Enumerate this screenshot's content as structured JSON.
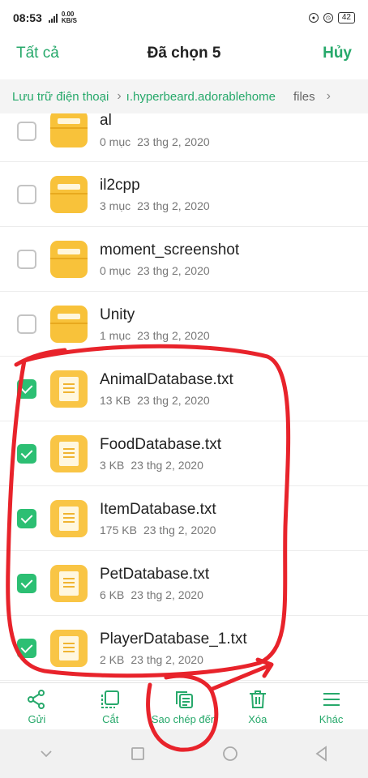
{
  "status": {
    "time": "08:53",
    "network_speed_top": "0.00",
    "network_speed_bottom": "KB/S",
    "battery": "42"
  },
  "header": {
    "select_all": "Tất cả",
    "title": "Đã chọn 5",
    "cancel": "Hủy"
  },
  "breadcrumb": {
    "root": "Lưu trữ điện thoại",
    "folder": "ı.hyperbeard.adorablehome",
    "current": "files"
  },
  "files": [
    {
      "name": "al",
      "meta": "0 mục",
      "date": "23 thg 2, 2020",
      "kind": "folder",
      "checked": false
    },
    {
      "name": "il2cpp",
      "meta": "3 mục",
      "date": "23 thg 2, 2020",
      "kind": "folder",
      "checked": false
    },
    {
      "name": "moment_screenshot",
      "meta": "0 mục",
      "date": "23 thg 2, 2020",
      "kind": "folder",
      "checked": false
    },
    {
      "name": "Unity",
      "meta": "1 mục",
      "date": "23 thg 2, 2020",
      "kind": "folder",
      "checked": false
    },
    {
      "name": "AnimalDatabase.txt",
      "meta": "13 KB",
      "date": "23 thg 2, 2020",
      "kind": "text-file",
      "checked": true
    },
    {
      "name": "FoodDatabase.txt",
      "meta": "3 KB",
      "date": "23 thg 2, 2020",
      "kind": "text-file",
      "checked": true
    },
    {
      "name": "ItemDatabase.txt",
      "meta": "175 KB",
      "date": "23 thg 2, 2020",
      "kind": "text-file",
      "checked": true
    },
    {
      "name": "PetDatabase.txt",
      "meta": "6 KB",
      "date": "23 thg 2, 2020",
      "kind": "text-file",
      "checked": true
    },
    {
      "name": "PlayerDatabase_1.txt",
      "meta": "2 KB",
      "date": "23 thg 2, 2020",
      "kind": "text-file",
      "checked": true
    }
  ],
  "toolbar": {
    "share": "Gửi",
    "cut": "Cắt",
    "copy": "Sao chép đến",
    "delete": "Xóa",
    "more": "Khác"
  },
  "colors": {
    "accent": "#27a96b",
    "checkbox_checked": "#2cbf73",
    "icon_yellow": "#f8c23a",
    "annotation_red": "#e8232b"
  },
  "icons": [
    "share-icon",
    "cut-icon",
    "copy-to-icon",
    "trash-icon",
    "menu-icon",
    "nav-down-icon",
    "nav-recents-icon",
    "nav-home-icon",
    "nav-back-icon"
  ]
}
